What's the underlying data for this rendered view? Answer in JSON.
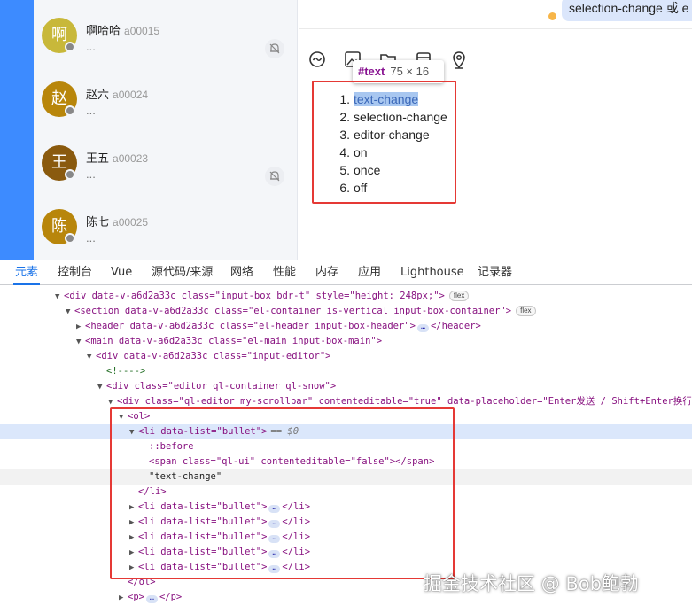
{
  "contacts": [
    {
      "avatar_char": "啊",
      "avatar_color": "#c8b83a",
      "name": "啊哈哈",
      "id": "a00015",
      "preview": "...",
      "muted": true
    },
    {
      "avatar_char": "赵",
      "avatar_color": "#b8860b",
      "name": "赵六",
      "id": "a00024",
      "preview": "...",
      "muted": false
    },
    {
      "avatar_char": "王",
      "avatar_color": "#8a5a0e",
      "name": "王五",
      "id": "a00023",
      "preview": "...",
      "muted": true
    },
    {
      "avatar_char": "陈",
      "avatar_color": "#b8860b",
      "name": "陈七",
      "id": "a00025",
      "preview": "...",
      "muted": false
    }
  ],
  "chat": {
    "bubble_text": "selection-change 或 e",
    "toolbar_icons": [
      "emoji-icon",
      "image-icon",
      "folder-icon",
      "history-icon",
      "location-icon"
    ]
  },
  "tooltip": {
    "name": "#text",
    "size": "75 × 16"
  },
  "editor_items": [
    {
      "num": "1.",
      "text": "text-change"
    },
    {
      "num": "2.",
      "text": "selection-change"
    },
    {
      "num": "3.",
      "text": "editor-change"
    },
    {
      "num": "4.",
      "text": "on"
    },
    {
      "num": "5.",
      "text": "once"
    },
    {
      "num": "6.",
      "text": "off"
    }
  ],
  "devtools": {
    "tabs": [
      "元素",
      "控制台",
      "Vue",
      "源代码/来源",
      "网络",
      "性能",
      "内存",
      "应用",
      "Lighthouse",
      "记录器"
    ],
    "active_tab": "元素",
    "lines": [
      {
        "t": "<div data-v-a6d2a33c class=\"input-box bdr-t\" style=\"height: 248px;\">",
        "badge": "flex"
      },
      {
        "t": "<section data-v-a6d2a33c class=\"el-container is-vertical input-box-container\">",
        "badge": "flex"
      },
      {
        "t": "<header data-v-a6d2a33c class=\"el-header input-box-header\">",
        "tail": "</header>"
      },
      {
        "t": "<main data-v-a6d2a33c class=\"el-main input-box-main\">"
      },
      {
        "t": "<div data-v-a6d2a33c class=\"input-editor\">"
      },
      {
        "t": "<!---->"
      },
      {
        "t": "<div class=\"editor ql-container ql-snow\">"
      },
      {
        "t": "<div class=\"ql-editor my-scrollbar\" contenteditable=\"true\" data-placeholder=\"Enter发送 / Shift+Enter换行\">"
      },
      {
        "t": "<ol>"
      },
      {
        "t": "<li data-list=\"bullet\">",
        "extra": "== $0"
      },
      {
        "t": "::before"
      },
      {
        "t": "<span class=\"ql-ui\" contenteditable=\"false\"></span>"
      },
      {
        "t": "\"text-change\""
      },
      {
        "t": "</li>"
      },
      {
        "t": "<li data-list=\"bullet\">",
        "tail": "</li>"
      },
      {
        "t": "<li data-list=\"bullet\">",
        "tail": "</li>"
      },
      {
        "t": "<li data-list=\"bullet\">",
        "tail": "</li>"
      },
      {
        "t": "<li data-list=\"bullet\">",
        "tail": "</li>"
      },
      {
        "t": "<li data-list=\"bullet\">",
        "tail": "</li>"
      },
      {
        "t": "</ol>"
      },
      {
        "t": "<p>",
        "tail": "</p>"
      }
    ]
  },
  "watermark": "掘金技术社区 @ Bob鲍勃"
}
